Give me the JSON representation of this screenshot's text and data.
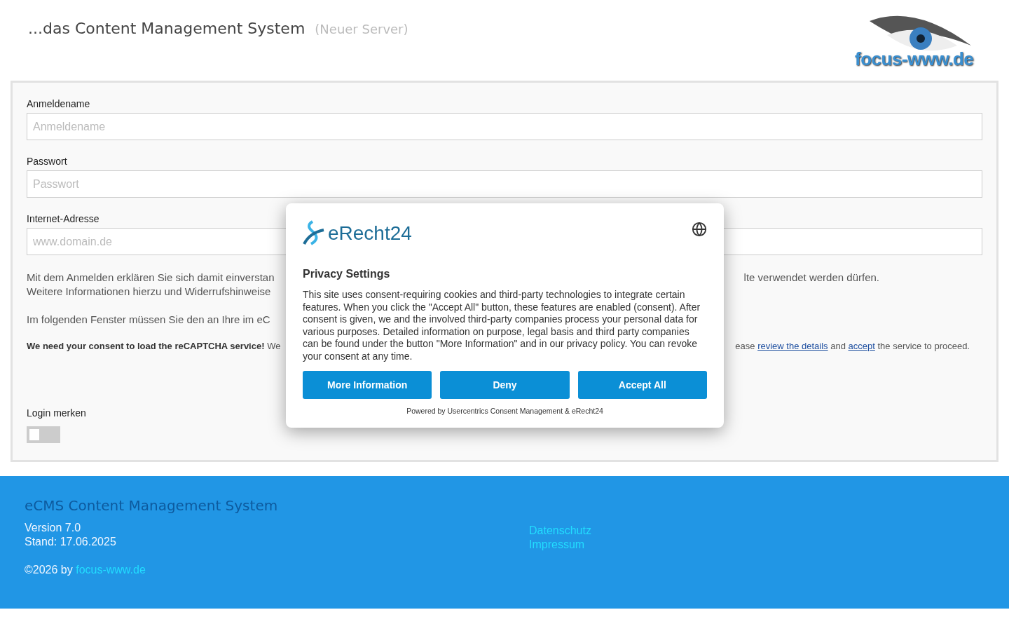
{
  "header": {
    "title": "...das Content Management System",
    "subtitle": "(Neuer Server)",
    "logo_text": "focus-www.de"
  },
  "form": {
    "fields": [
      {
        "label": "Anmeldename",
        "placeholder": "Anmeldename"
      },
      {
        "label": "Passwort",
        "placeholder": "Passwort"
      },
      {
        "label": "Internet-Adresse",
        "placeholder": "www.domain.de"
      }
    ],
    "notice_lines": [
      {
        "left": "Mit dem Anmelden erklären Sie sich damit einverstan",
        "right": "lte verwendet werden dürfen."
      },
      {
        "left": "Weitere Informationen hierzu und Widerrufshinweise"
      },
      {
        "left": "Im folgenden Fenster müssen Sie den an Ihre im eC"
      }
    ],
    "consent_line": {
      "left": "**We need your consent to load the reCAPTCHA service!** We",
      "right_before": "ease",
      "link1": "review the details",
      "middle": "and",
      "link2": "accept",
      "right_after": "the service to proceed."
    },
    "remember": {
      "label": "Login merken",
      "on": false
    }
  },
  "footer": {
    "title": "eCMS Content Management System",
    "version": "Version 7.0",
    "date": "Stand: 17.06.2025",
    "copyright": "©2026 by",
    "copyright_link": "focus-www.de",
    "links": [
      "Datenschutz",
      "Impressum"
    ]
  },
  "consent_dialog": {
    "brand": "eRecht24",
    "title": "Privacy Settings",
    "text": "This site uses consent-requiring cookies and third-party technologies to integrate certain features. When you click the \"Accept All\" button, these features are enabled (consent). After consent is given, we and the involved third-party companies process your personal data for various purposes. Detailed information on purpose, legal basis and third party companies can be found under the button \"More Information\" and in our privacy policy. You can revoke your consent at any time.",
    "buttons": [
      "More Information",
      "Deny",
      "Accept All"
    ],
    "powered_by": "Powered by Usercentrics Consent Management & eRecht24"
  }
}
